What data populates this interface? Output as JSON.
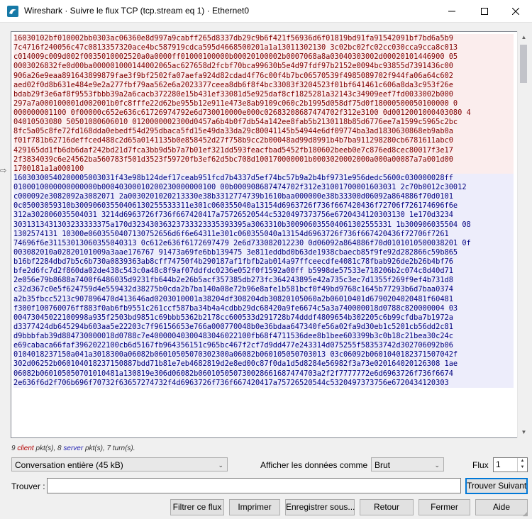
{
  "window": {
    "title": "Wireshark · Suivre le flux TCP (tcp.stream eq 1) · Ethernet0"
  },
  "stream": {
    "client_lines": [
      "16030102bf010002bb0303ac06360e8d997a9cabff265d8337db29c9b6f421f56936d6f01819bd91fa91542091bf7bd6a5b9",
      "7c4716f240056c47c0813357320ace4bc587919cdca595d4668500201a1a13011302130 3c02bc02fc02cc030cca9cca8c013",
      "c014009c009d002f0035010002520a0a0000ff01000100000b00020100002b0007068a8a03040303002d00020101446900 05",
      "0003026832fe0d00ba000001000144002065ac627658d2fcbf70bca99630b5e4d97fdf97b2152e0094bc93855d7391436c00",
      "906a26e9eaa891643899879fae3f9bf2502fa07aefa924d82cdad4f76c00f4b7bc06570539f4985089702f944fa06a64c602",
      "aed02f0d8b631e484e9e2a277fbf79aa562e6a2023377ceea8db6f8f4bc33083f3204523f01bf641461c606a8da3c953f26e",
      "bdab29f3e6af8f9553fbbb39a2a6cacb372280e15b431ef33081d5e925daf8cf1825281a32143c34909eef7fd0033002b000",
      "297a7a000100001d002001b0fc8fffe22d62be955b12e911e473e8ab9109c060c2b1995d058df75d0f18000500050100000 0",
      "000000001100 0f00000c652e636c61726974792e6d730010000e000c02683208687474702f312e3100 0d0012001000403080 4",
      "04010503080 50501080606010 0120000002300d0457a6b4b0f7db54a142ee8fab5b2130118b85d6776ee7a1599c5965c2bc",
      "8fc5a05c8fe72fd168dda0ebedf54d295dbaca5fd15e49da33da29c80041145b54944e6df09774ba3ad1830630868eb9ab0a",
      "f01f781b62716deffced488c2d65a0141135b0e858452d27f758b9cc2b00048ad99d8991b4b7ba911298280cb6781611abc0",
      "429165dd1fb6db6daf242bd21d7fca3bb9d5b7a7b01ef321dd593feacfbad5452fb180602beeb0e7c876ed8cec80017f3e17",
      "2f3834039c6e24562ba560783f501d3523f59720fb3ef62d5bc708d100170000001b0003020002000a000a00087a7a001d00",
      "1700181a1a000100"
    ],
    "server_lines": [
      "16030300540200005003031f43e98b124def17ceab951fcd7b4337d5ef74bc57b9a2b4bf9731e956dedc5600c030000028ff",
      "0100010000000000000b00040300010200230000000100 00b000908687474702f312e31001700001603031 2c70b0012c30012",
      "c000092e3082092a3082071 2a0030201020213330e38b3312774739b1610baa000000e38b33300d06092a864886f70d0101",
      "0c05003059310b30090603550406130255533311e301c060355040a13154d6963726f736f667420436f72706f726174696f6e",
      "312a302806035504031 3214d6963726f736f667420417a75726520544c5320497373756e6720434120303130 1e170d3234",
      "3031313431303233333375a170d32343036323733323335393395a3063310b300906035504061302555331 1b300906035504 08",
      "1302574131 10300e0603550407130752656d6f6e64311e301c060355040a13154d6963726f736f667420436f72706f7261",
      "74696f6e31153013060355040313 0c612e636f6172697479 2e6d733082012230 0d06092a864886f70d0101010500038201 0f",
      "003082010a02820101009a3aae176767 91473a69fe6bb139475 3e811eddbd0b63de1938cbaecb85f9fe92d282866c59b865",
      "b16bf2284dbd7b5c6b730a0839363ab8cff74750f4b290187af1fbfb2ab014a97ffceecdfe4081c78fbab926de2b26b4bf76",
      "bfe2d6fc7d2f860da02de438c543c0a48c8f9af07ddfdc0236e052f0f1592a00ff b5998de57533e718206b2c074c8d40d71",
      "2e056e79b8688a7400f6486035d9231fb644b2e26b5acf357385db273fc364243895e42a735c3ec7d1355f269f9ef4b731d8",
      "c32d367c0e5f624759d4e559432d38275b0cda2b7ba140a08e72b96e8afe1b581bcf0f49bd9768c1645b77293b6d7baa0374",
      "a2b35fbcc5213c907896470d413646ad0203010001a38204df308204db30820105060a2b06010401d6790204020481f60481",
      "f300f100760076ff883f0ab6fb9551c261ccf587ba34b4a4cdbb29dc68420a9fe6674c5a3a740000018d0788c820000004 03",
      "00473045022100998a935f2503bd9851c69bbb5362b2178cc600533d291728b74dddf4809654b302205c6b99cfdba7b1972a",
      "d3377424db645294b603aa5e22203c7f96156653e766a000770048b0e36bdaa647340fe56a02fa9d30eb1c5201cb56dd2c81",
      "d9bbbfab39d884730000018d0788c7e40000040300483046022100fb68f4711536dee8b1bee603399b3c0b18c21bea30c24c",
      "e69cabaca66faf3962022100cb6d5167fb964356151c965bc467f2cf7d9dd477e243314d075255f58353742d302706092b06",
      "0104018237150a041a3018300a06082b06010505070302300a06082b060105050703013 03c06092b0601040182371507042f",
      "302d06252b060104018237150887bdd71b81e7eb4682819d2e8ed00c87f0da1d5d8284e56982f3a73e020164020126308 1ae",
      "06082b060105050701010481a130819e306d06082b060105050730028661687474703a2f2f7777772e6d6963726f736f6674",
      "2e636f6d2f706b696f70732f63657274732f4d6963726f736f667420417a75726520544c5320497373756e6720434120303"
    ]
  },
  "stats": {
    "client_count": "9",
    "client_word": "client",
    "server_count": "8",
    "server_word": "server",
    "pkt_suffix": "pkt(s),",
    "turns": "7 turn(s)."
  },
  "controls": {
    "conversation_value": "Conversation entière (45 kB)",
    "show_as_label": "Afficher les données comme",
    "show_as_value": "Brut",
    "flux_label": "Flux",
    "flux_value": "1",
    "find_label": "Trouver :",
    "find_value": "",
    "find_next": "Trouver Suivant"
  },
  "buttons": {
    "filter": "Filtrer ce flux",
    "print": "Imprimer",
    "save": "Enregistrer sous...",
    "back": "Retour",
    "close": "Fermer",
    "help": "Aide"
  },
  "colors": {
    "client_bg": "#fbeded",
    "client_fg": "#7f0000",
    "server_bg": "#ededfb",
    "server_fg": "#00007f",
    "accent": "#0078d7"
  }
}
